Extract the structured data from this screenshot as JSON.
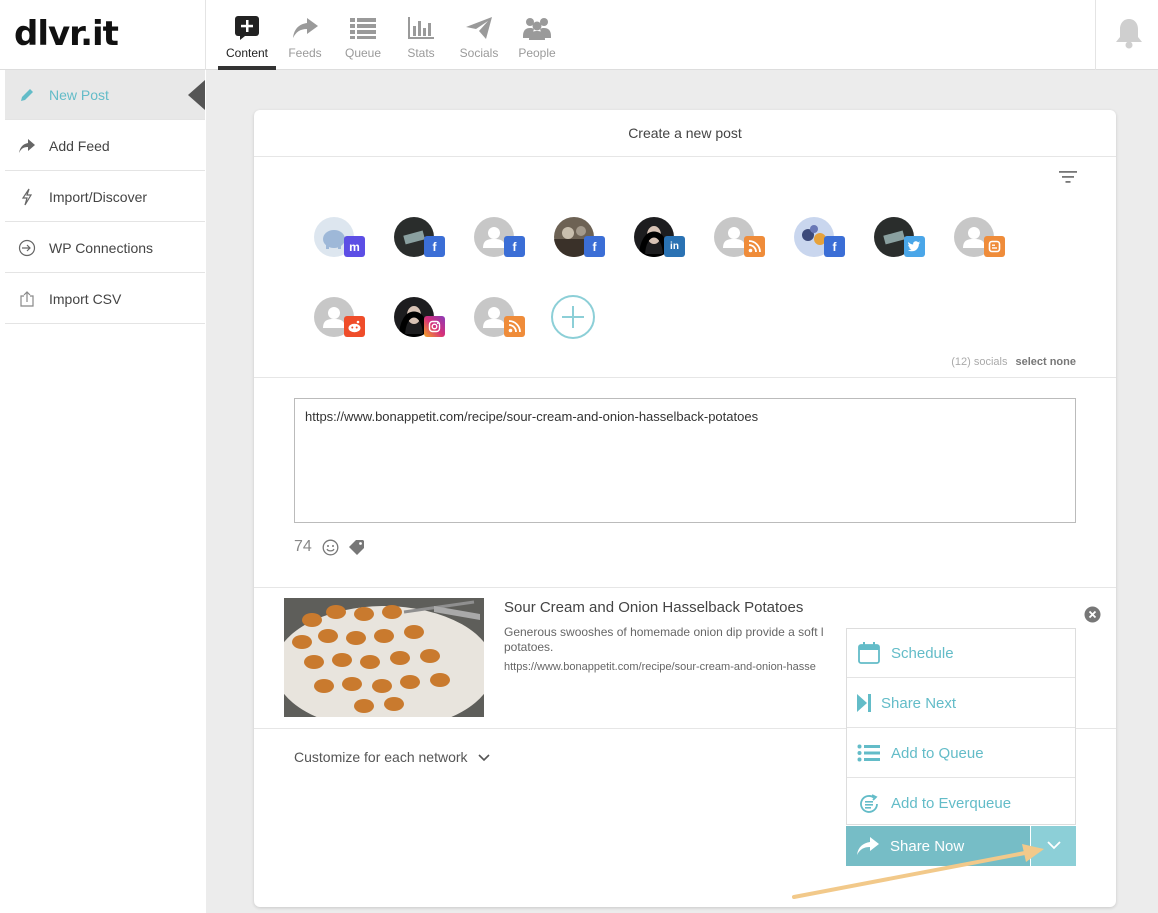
{
  "app": {
    "logo": "dlvr.it"
  },
  "nav": [
    {
      "label": "Content",
      "icon": "plus-square-icon",
      "active": true
    },
    {
      "label": "Feeds",
      "icon": "share-arrow-icon"
    },
    {
      "label": "Queue",
      "icon": "list-icon"
    },
    {
      "label": "Stats",
      "icon": "bar-chart-icon"
    },
    {
      "label": "Socials",
      "icon": "paper-plane-icon"
    },
    {
      "label": "People",
      "icon": "people-icon"
    }
  ],
  "sidebar": {
    "items": [
      {
        "label": "New Post",
        "icon": "pencil-icon",
        "active": true
      },
      {
        "label": "Add Feed",
        "icon": "share-arrow-icon"
      },
      {
        "label": "Import/Discover",
        "icon": "lightning-icon"
      },
      {
        "label": "WP Connections",
        "icon": "sign-in-icon"
      },
      {
        "label": "Import CSV",
        "icon": "upload-icon"
      }
    ]
  },
  "card": {
    "title": "Create a new post",
    "socials_count": "(12) socials",
    "select_none": "select none",
    "socials": [
      {
        "network": "mastodon",
        "color": "#5c4ee5",
        "letter": "m"
      },
      {
        "network": "facebook",
        "color": "#3b6ed6",
        "letter": "f"
      },
      {
        "network": "facebook",
        "color": "#3b6ed6",
        "letter": "f"
      },
      {
        "network": "facebook",
        "color": "#3b6ed6",
        "letter": "f"
      },
      {
        "network": "linkedin",
        "color": "#2a72b3",
        "letter": "in"
      },
      {
        "network": "rss",
        "color": "#ef8c3a",
        "letter": ")"
      },
      {
        "network": "facebook",
        "color": "#3b6ed6",
        "letter": "f"
      },
      {
        "network": "twitter",
        "color": "#4aa6e8",
        "letter": "t"
      },
      {
        "network": "blogger",
        "color": "#ef8c3a",
        "letter": "B"
      },
      {
        "network": "reddit",
        "color": "#ef4d2a",
        "letter": "r"
      },
      {
        "network": "instagram",
        "color": "#d6307a",
        "letter": "o"
      },
      {
        "network": "rss",
        "color": "#ef8c3a",
        "letter": ")"
      }
    ],
    "post_text": "https://www.bonappetit.com/recipe/sour-cream-and-onion-hasselback-potatoes",
    "char_count": "74",
    "preview": {
      "title": "Sour Cream and Onion Hasselback Potatoes",
      "description": "Generous swooshes of homemade onion dip provide a soft l",
      "description_end": "potatoes.",
      "url": "https://www.bonappetit.com/recipe/sour-cream-and-onion-hasse"
    },
    "customize_label": "Customize for each network"
  },
  "dropdown": {
    "items": [
      {
        "label": "Schedule",
        "icon": "calendar-icon"
      },
      {
        "label": "Share Next",
        "icon": "skip-next-icon"
      },
      {
        "label": "Add to Queue",
        "icon": "list-icon"
      },
      {
        "label": "Add to Everqueue",
        "icon": "refresh-list-icon"
      }
    ],
    "share_now": "Share Now"
  },
  "colors": {
    "accent": "#63bcc8",
    "button": "#76bdc6",
    "arrow": "#f2c98a"
  }
}
